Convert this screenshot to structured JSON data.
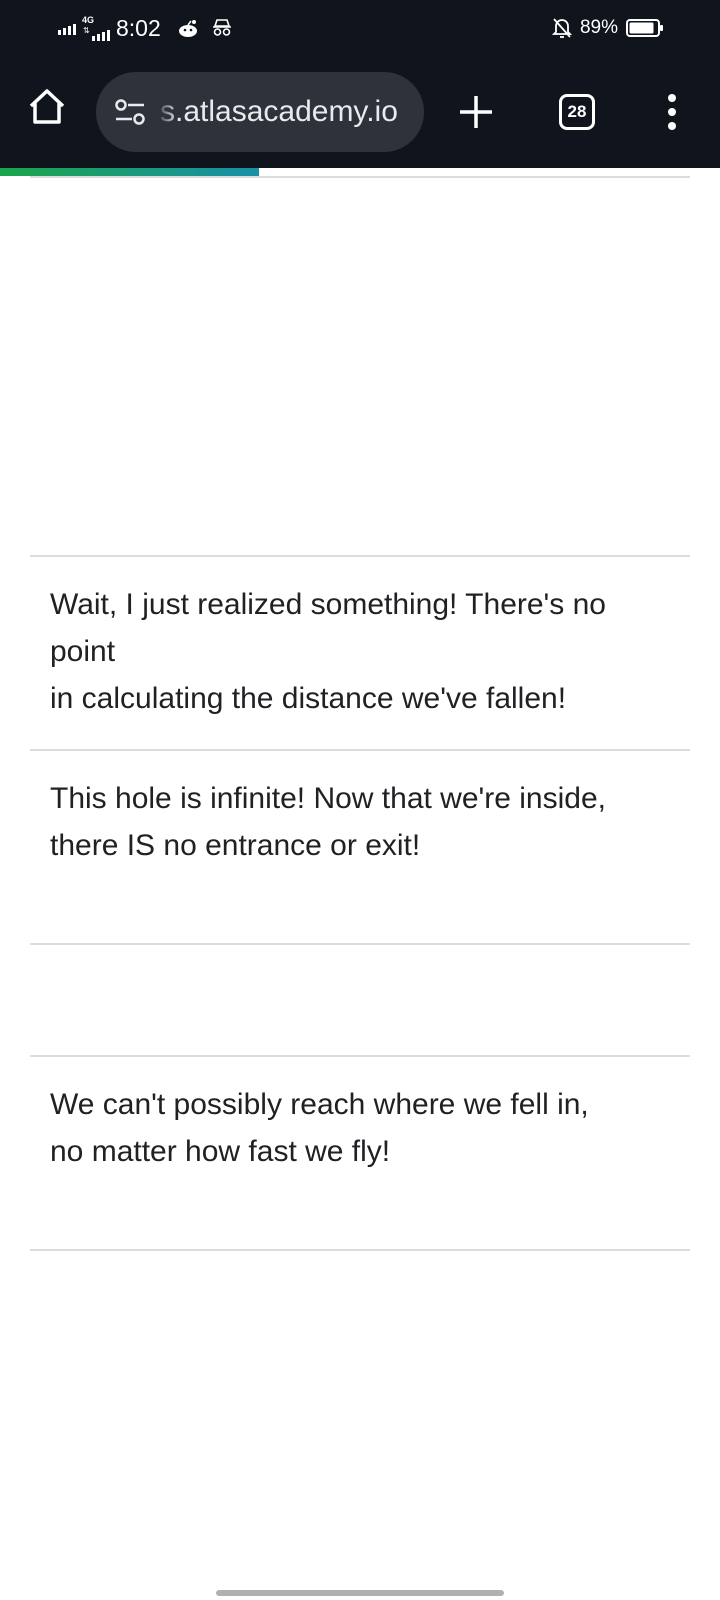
{
  "status_bar": {
    "time": "8:02",
    "network_label": "4G",
    "battery_percent": "89%",
    "battery_level": 0.89,
    "icons": [
      "signal-icon",
      "4g-signal-icon",
      "reddit-icon",
      "incognito-icon",
      "bell-off-icon",
      "battery-icon"
    ]
  },
  "browser": {
    "url_display": "s.atlasacademy.io",
    "tab_count": "28",
    "load_progress": 0.36
  },
  "content": {
    "rows": [
      {
        "text": ""
      },
      {
        "text": "Wait, I just realized something! There's no point\nin calculating the distance we've fallen!"
      },
      {
        "text": "This hole is infinite! Now that we're inside,\nthere IS no entrance or exit!"
      },
      {
        "text": ""
      },
      {
        "text": "We can't possibly reach where we fell in,\nno matter how fast we fly!"
      }
    ]
  },
  "colors": {
    "toolbar_bg": "#10141c",
    "url_pill_bg": "#2e333b",
    "progress_start": "#1aa64a",
    "progress_end": "#1a8fa8",
    "divider": "#dadcdd",
    "text": "#202124"
  }
}
